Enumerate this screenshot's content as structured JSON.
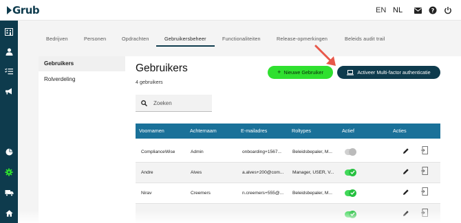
{
  "app": {
    "logo_text": "Grub"
  },
  "header": {
    "languages": [
      "EN",
      "NL"
    ],
    "active_language": "NL",
    "icons": [
      "mail-icon",
      "help-icon",
      "power-icon"
    ]
  },
  "sidebar": {
    "icons": [
      "building-icon",
      "person-icon",
      "checklist-icon",
      "megaphone-icon",
      "pie-chart-icon",
      "settings-gear-icon",
      "truck-icon",
      "home-icon"
    ],
    "active_icon": "settings-gear-icon",
    "accent_active": "#2fe02f",
    "background": "#0e3b4d"
  },
  "tabs": {
    "items": [
      "Bedrijven",
      "Personen",
      "Opdrachten",
      "Gebruikersbeheer",
      "Functionaliteiten",
      "Release-opmerkingen",
      "Beleids audit trail"
    ],
    "active": "Gebruikersbeheer"
  },
  "left_menu": {
    "items": [
      "Gebruikers",
      "Rolverdeling"
    ],
    "active": "Gebruikers"
  },
  "page": {
    "title": "Gebruikers",
    "count_text": "4 gebruikers"
  },
  "buttons": {
    "new_user": "Nieuwe Gebruiker",
    "new_user_icon": "plus-icon",
    "mfa": "Activeer Multi-factor authenticatie",
    "mfa_icon": "laptop-icon"
  },
  "search": {
    "placeholder": "Zoeken",
    "value": ""
  },
  "table": {
    "header_color": "#1a7199",
    "columns": [
      "Voornamen",
      "Achternaam",
      "E-mailadres",
      "Roltypes",
      "Actief",
      "Acties"
    ],
    "rows": [
      {
        "first": "ComplianceWise",
        "last": "Admin",
        "email": "onboarding+1567...",
        "roles": "Beleidsbepaler, M...",
        "active": false
      },
      {
        "first": "Andre",
        "last": "Alves",
        "email": "a.alves+200@com...",
        "roles": "Manager, USER, V...",
        "active": true
      },
      {
        "first": "Nirav",
        "last": "Creemers",
        "email": "n.creemers+555@...",
        "roles": "Beleidsbepaler, M...",
        "active": true
      },
      {
        "first": "",
        "last": "",
        "email": "",
        "roles": "",
        "active": true
      }
    ],
    "action_icons": [
      "edit-pencil-icon",
      "logout-document-icon"
    ]
  },
  "annotation": {
    "arrow_color": "#e8584a"
  }
}
